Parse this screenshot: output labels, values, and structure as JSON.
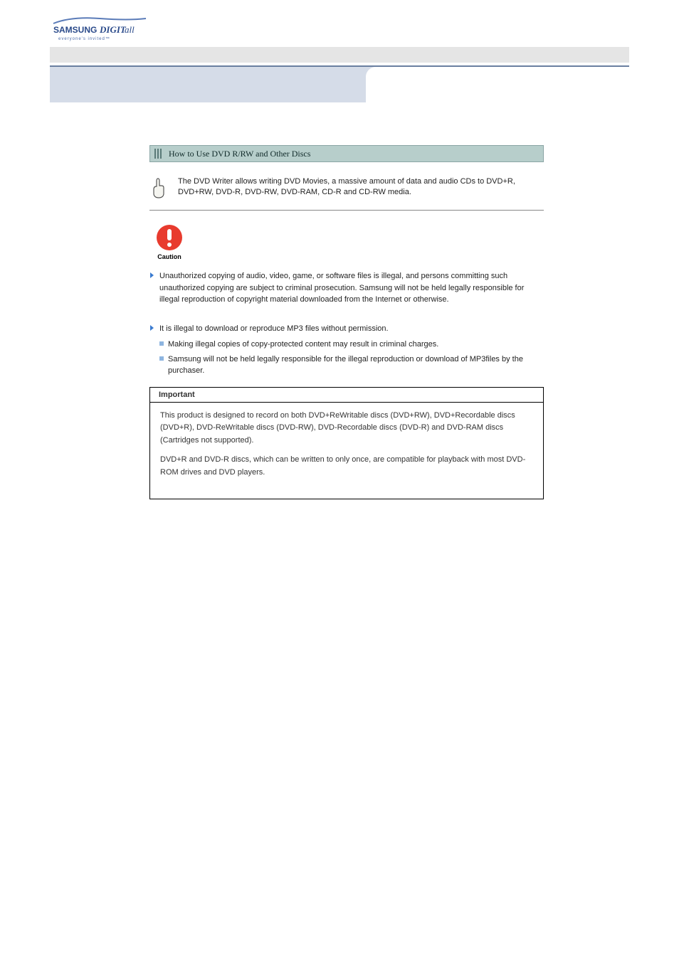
{
  "section_title": "How to Use DVD R/RW and Other Discs",
  "tip_text": "The DVD Writer allows writing DVD Movies, a massive amount of data and audio CDs to DVD+R, DVD+RW, DVD-R, DVD-RW, DVD-RAM, CD-R and CD-RW media.",
  "caution_label": "Caution",
  "bullet1": "Unauthorized copying of audio, video, game, or software files is illegal, and persons committing such unauthorized copying are subject to criminal prosecution. Samsung will not be held legally responsible for illegal reproduction of copyright material downloaded from the Internet or otherwise.",
  "bullet2_head": "It is illegal to download or reproduce MP3 files without permission.",
  "sub1": "Making illegal copies of copy-protected content may result in criminal charges.",
  "sub2": "Samsung will not be held legally responsible for the illegal reproduction or download of MP3files by the purchaser.",
  "important_label": "Important",
  "important_p1": "This product is designed to record on both DVD+ReWritable discs (DVD+RW), DVD+Recordable discs (DVD+R), DVD-ReWritable discs (DVD-RW), DVD-Recordable discs (DVD-R) and DVD-RAM discs (Cartridges not supported).",
  "important_p2": "DVD+R and DVD-R discs, which can be written to only once, are compatible for playback with most DVD-ROM drives and DVD players."
}
